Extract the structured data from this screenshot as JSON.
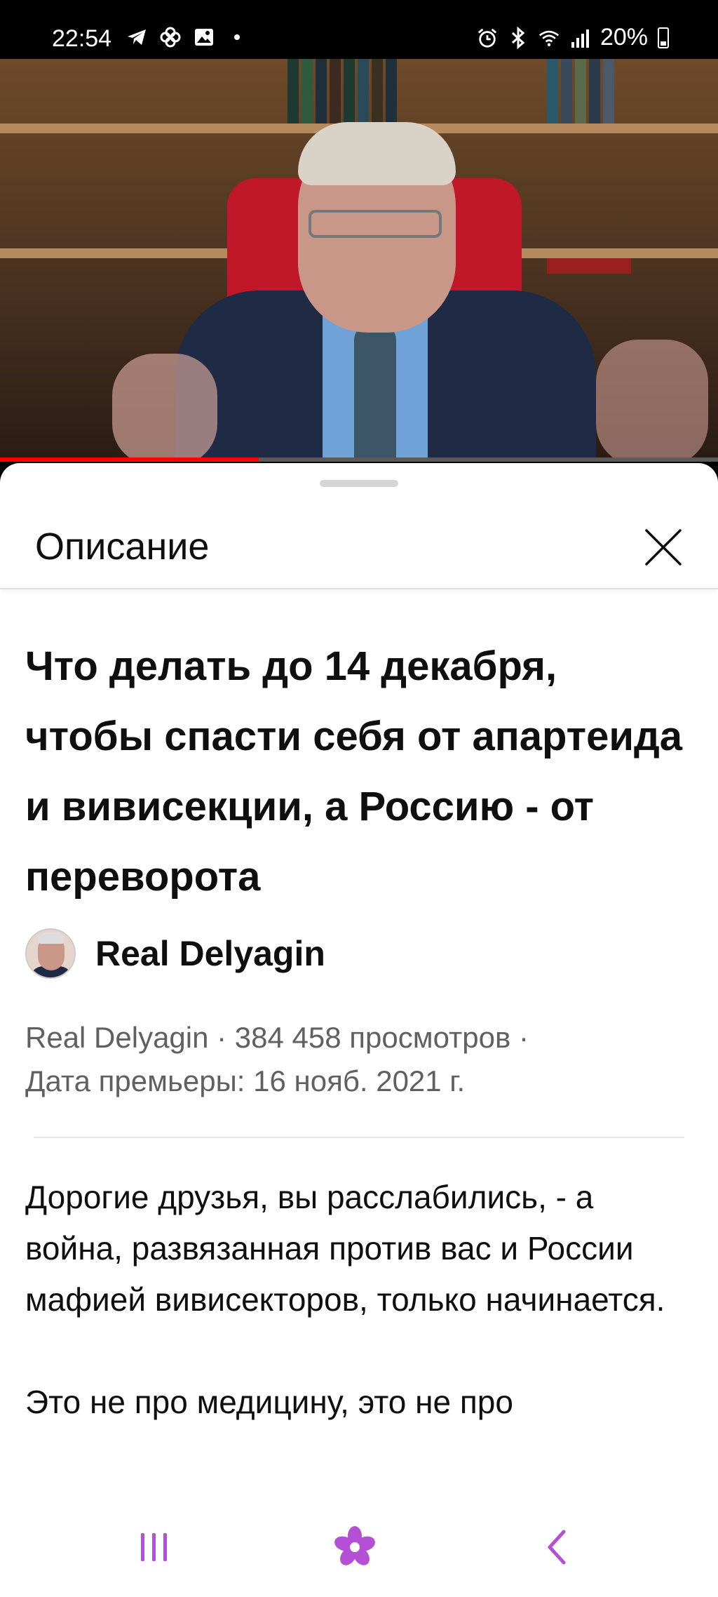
{
  "status_bar": {
    "time": "22:54",
    "battery": "20%",
    "left_icons": [
      "telegram-icon",
      "pinwheel-icon",
      "gallery-icon",
      "dot-icon"
    ],
    "right_icons": [
      "alarm-icon",
      "bluetooth-icon",
      "wifi-icon",
      "signal-icon",
      "battery-icon"
    ]
  },
  "player": {
    "progress": 0.36,
    "progress_color": "#ff0000"
  },
  "sheet": {
    "title": "Описание",
    "close_icon": "close-icon"
  },
  "video": {
    "title": "Что делать до 14 декабря, чтобы спасти себя от апартеида и вивисекции, а Россию - от переворота",
    "channel": "Real Delyagin",
    "meta_line1": "Real Delyagin · 384 458 просмотров ·",
    "meta_line2": "Дата премьеры: 16 нояб. 2021 г."
  },
  "description": {
    "paragraph1": "Дорогие друзья, вы расслабились, - а война, развязанная против вас и России мафией вивисекторов, только начинается.",
    "paragraph2": "Это не про медицину, это не про"
  },
  "bottom_nav": {
    "accent": "#b44fd6",
    "items": [
      "recent-apps-icon",
      "home-flower-icon",
      "back-icon"
    ]
  }
}
